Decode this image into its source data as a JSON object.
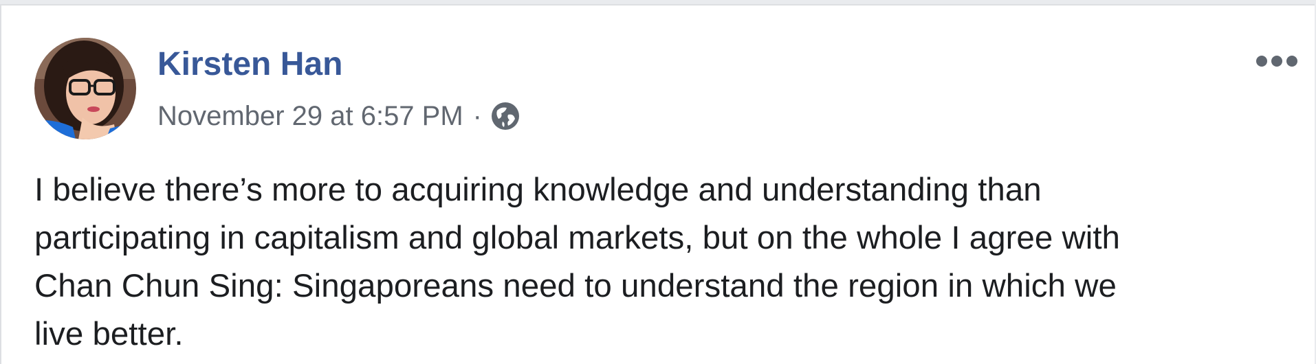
{
  "post": {
    "author": {
      "name": "Kirsten Han",
      "avatar_icon": "profile-photo"
    },
    "timestamp": "November 29 at 6:57 PM",
    "separator": "·",
    "privacy_icon": "globe-icon",
    "more_icon": "more-options-icon",
    "text": "I believe there’s more to acquiring knowledge and understanding than\nparticipating in capitalism and global markets, but on the whole I agree with\nChan Chun Sing: Singaporeans need to understand the region in which we\nlive better."
  },
  "colors": {
    "author_link": "#385898",
    "meta_text": "#616770",
    "body_text": "#1c1e21",
    "card_border": "#dddfe2",
    "page_background": "#e9ebee"
  }
}
